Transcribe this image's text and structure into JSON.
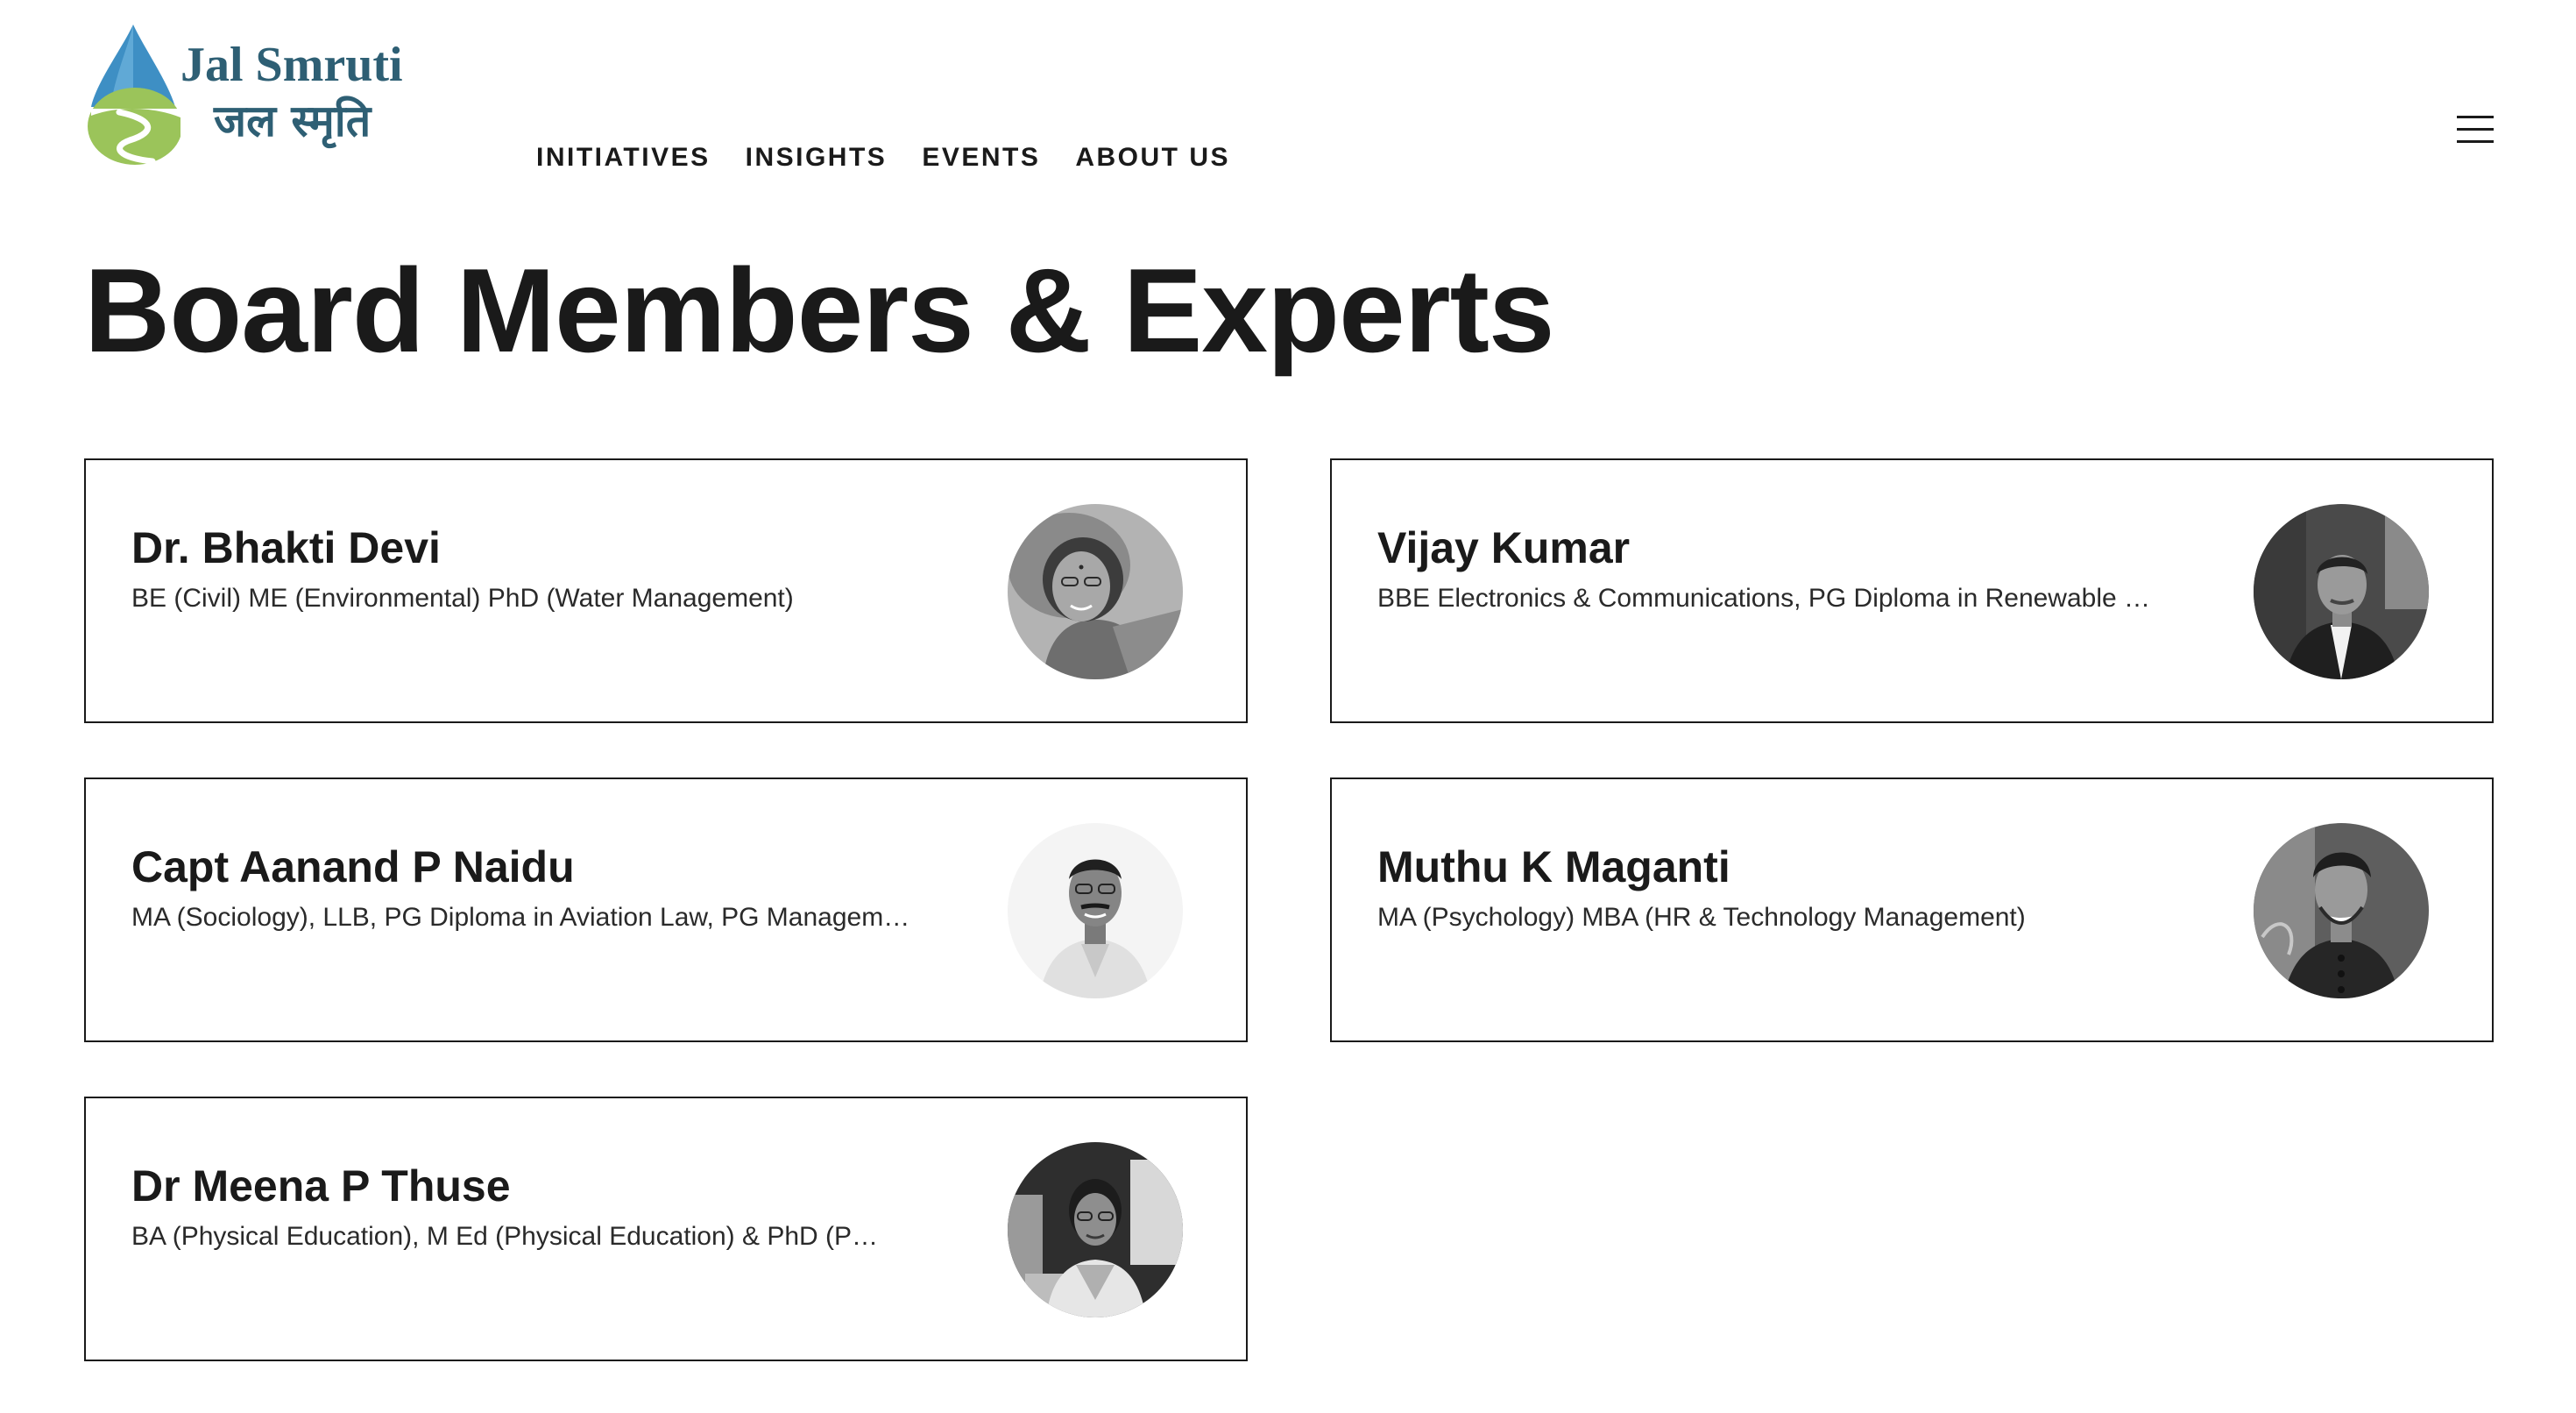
{
  "brand": {
    "name_en": "Jal Smruti",
    "name_hi": "जल स्मृति"
  },
  "nav": {
    "items": [
      {
        "label": "INITIATIVES"
      },
      {
        "label": "INSIGHTS"
      },
      {
        "label": "EVENTS"
      },
      {
        "label": "ABOUT US"
      }
    ],
    "menu_icon": "hamburger-menu-icon"
  },
  "page": {
    "title": "Board Members & Experts"
  },
  "members": [
    {
      "name": "Dr. Bhakti Devi",
      "qualifications": "BE (Civil) ME (Environmental) PhD (Water Management)"
    },
    {
      "name": "Vijay Kumar",
      "qualifications": "BBE Electronics & Communications, PG Diploma in Renewable E…"
    },
    {
      "name": "Capt Aanand P Naidu",
      "qualifications": "MA (Sociology), LLB, PG Diploma in Aviation Law, PG Managem…"
    },
    {
      "name": "Muthu K Maganti",
      "qualifications": "MA (Psychology) MBA (HR & Technology Management)"
    },
    {
      "name": "Dr Meena P Thuse",
      "qualifications": "BA (Physical Education), M Ed (Physical Education) & PhD (P…"
    }
  ],
  "colors": {
    "brand_text": "#2e5f74",
    "drop_blue": "#3e8fc4",
    "hill_green": "#9bc45a",
    "text_primary": "#1a1a1a",
    "card_border": "#1a1a1a"
  }
}
